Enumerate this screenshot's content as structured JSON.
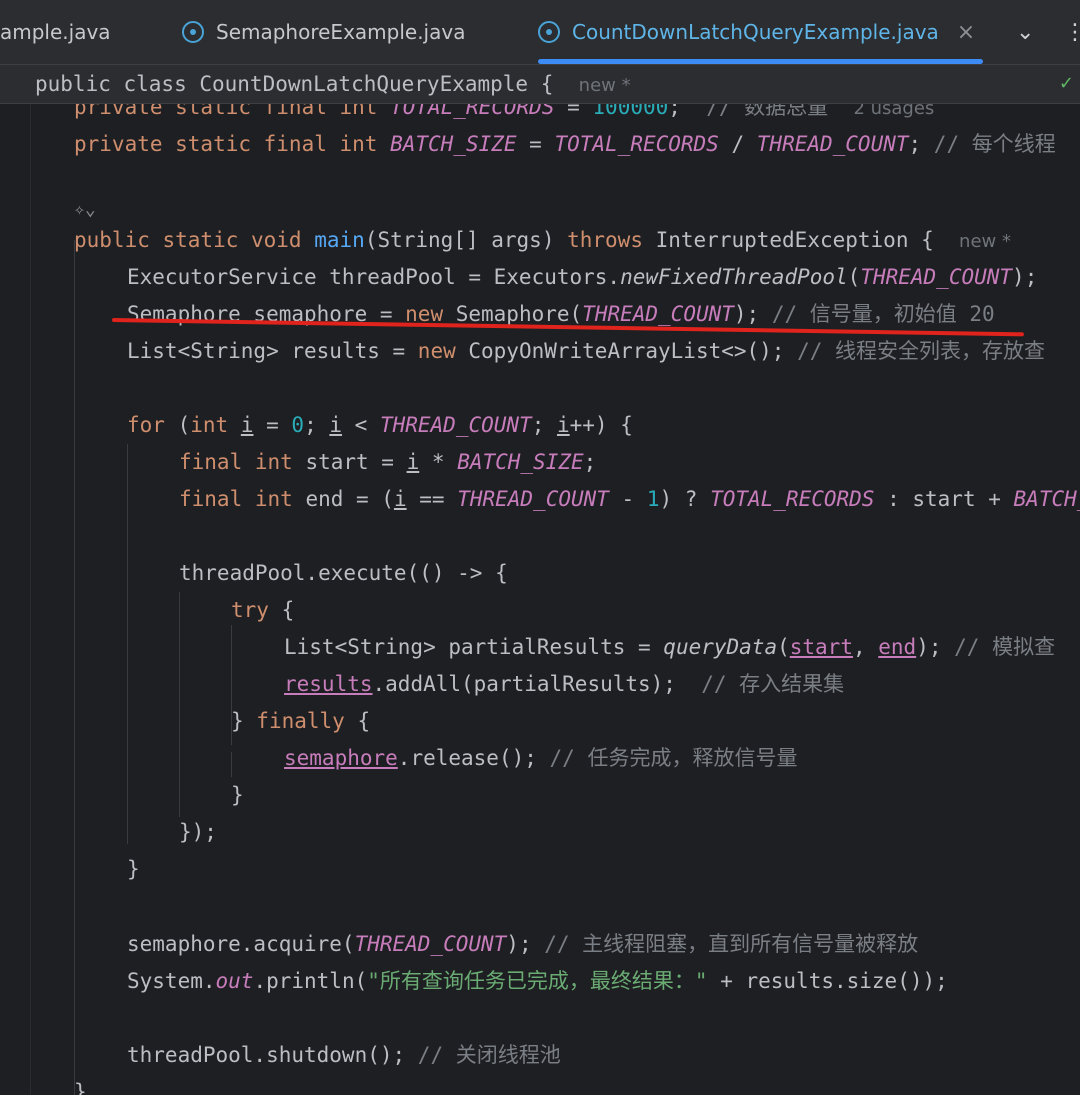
{
  "tabs": [
    {
      "label": "ample.java"
    },
    {
      "label": "SemaphoreExample.java"
    },
    {
      "label": "CountDownLatchQueryExample.java",
      "close": "×"
    }
  ],
  "tab_controls": {
    "dropdown": "⌄",
    "more": "⋮"
  },
  "sticky": {
    "code": "public class CountDownLatchQueryExample {",
    "hint": "new *"
  },
  "hints": {
    "usages": "2 usages",
    "main_new": "new *"
  },
  "code": {
    "total_records_comment": "// 数据总量",
    "batch_size_comment": "// 每个线程",
    "semaphore_comment": "// 信号量，初始值 20",
    "results_comment": "// 线程安全列表，存放查",
    "query_comment": "// 模拟查",
    "addall_comment": "// 存入结果集",
    "release_comment": "// 任务完成，释放信号量",
    "acquire_comment": "// 主线程阻塞，直到所有信号量被释放",
    "println_string": "\"所有查询任务已完成，最终结果：\"",
    "shutdown_comment": "// 关闭线程池"
  },
  "colors": {
    "background": "#1e1f22",
    "keyword": "#cf8e6d",
    "constant": "#c77dbb",
    "number": "#2aacb8",
    "method": "#56a8f5",
    "comment": "#7a7e85",
    "string": "#6aab73",
    "annotation_underline": "#e0231c",
    "active_tab": "#3d8cf5"
  }
}
